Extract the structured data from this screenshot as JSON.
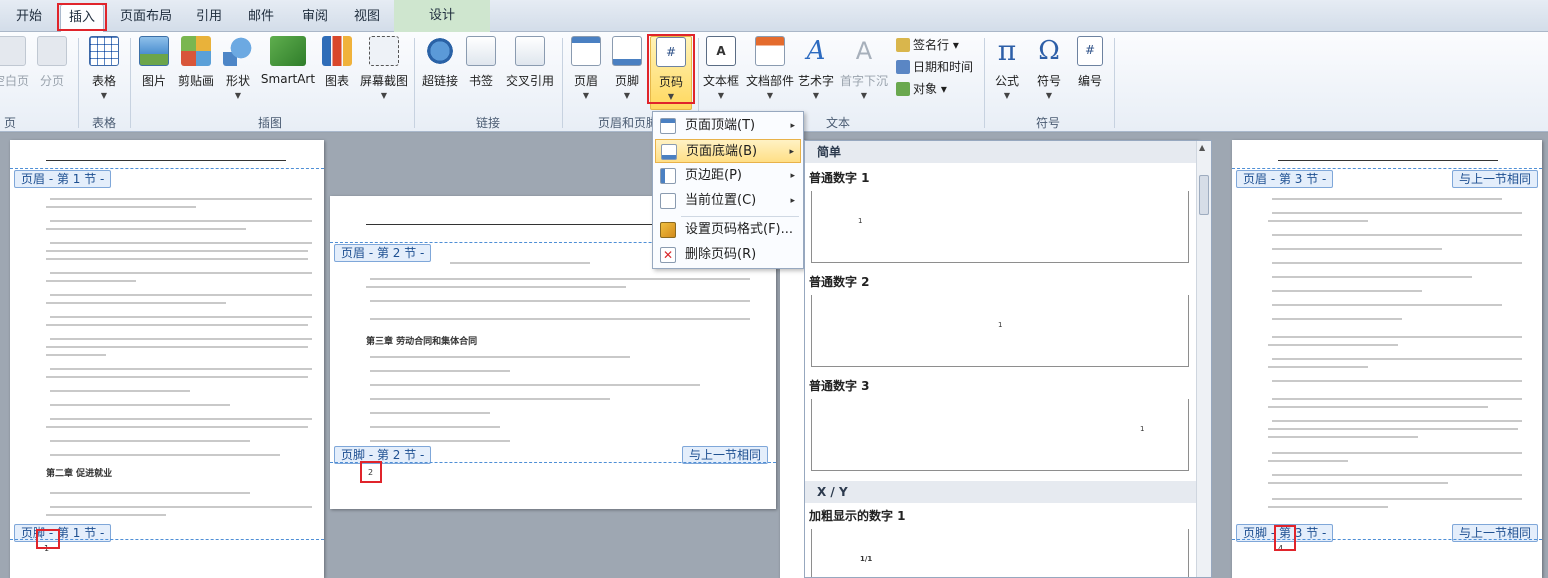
{
  "tabs": [
    "开始",
    "插入",
    "页面布局",
    "引用",
    "邮件",
    "审阅",
    "视图",
    "设计"
  ],
  "ribbon": {
    "groups": {
      "pages_partial": "页",
      "table": "表格",
      "illustrations": "插图",
      "links": "链接",
      "header_footer": "页眉和页脚",
      "text": "文本",
      "symbols": "符号"
    },
    "buttons": {
      "blank_page": "空白页",
      "page_break": "分页",
      "table": "表格",
      "picture": "图片",
      "clip_art": "剪贴画",
      "shapes": "形状",
      "smartart": "SmartArt",
      "chart": "图表",
      "screenshot": "屏幕截图",
      "hyperlink": "超链接",
      "bookmark": "书签",
      "cross_ref": "交叉引用",
      "header": "页眉",
      "footer": "页脚",
      "page_number": "页码",
      "text_box": "文本框",
      "quick_parts": "文档部件",
      "wordart": "艺术字",
      "drop_cap": "首字下沉",
      "signature_line": "签名行",
      "date_time": "日期和时间",
      "object": "对象",
      "equation": "公式",
      "symbol": "符号",
      "number": "编号"
    }
  },
  "menu": {
    "items": [
      {
        "label": "页面顶端(T)",
        "arrow": "▸"
      },
      {
        "label": "页面底端(B)",
        "arrow": "▸"
      },
      {
        "label": "页边距(P)",
        "arrow": "▸"
      },
      {
        "label": "当前位置(C)",
        "arrow": "▸"
      },
      {
        "label": "设置页码格式(F)...",
        "arrow": ""
      },
      {
        "label": "删除页码(R)",
        "arrow": ""
      }
    ]
  },
  "gallery": {
    "section1": "简单",
    "items": [
      {
        "title": "普通数字 1",
        "num": "1"
      },
      {
        "title": "普通数字 2",
        "num": "1"
      },
      {
        "title": "普通数字 3",
        "num": "1"
      }
    ],
    "section2": "X / Y",
    "item4": {
      "title": "加粗显示的数字 1",
      "num": "1/1"
    }
  },
  "pages": {
    "p1": {
      "header_tag": "页眉 - 第 1 节 -",
      "footer_tag": "页脚 - 第 1 节 -",
      "page_num": "1",
      "chapter": "第二章 促进就业"
    },
    "p2": {
      "header_tag": "页眉 - 第 2 节 -",
      "footer_tag": "页脚 - 第 2 节 -",
      "same_as_prev": "与上一节相同",
      "page_num": "2",
      "chapter": "第三章 劳动合同和集体合同"
    },
    "p3": {
      "header_tag": "页眉 - 第 3 节 -",
      "footer_tag": "页脚 - 第 3 节 -",
      "same_as_prev": "与上一节相同",
      "page_num": "4"
    }
  }
}
